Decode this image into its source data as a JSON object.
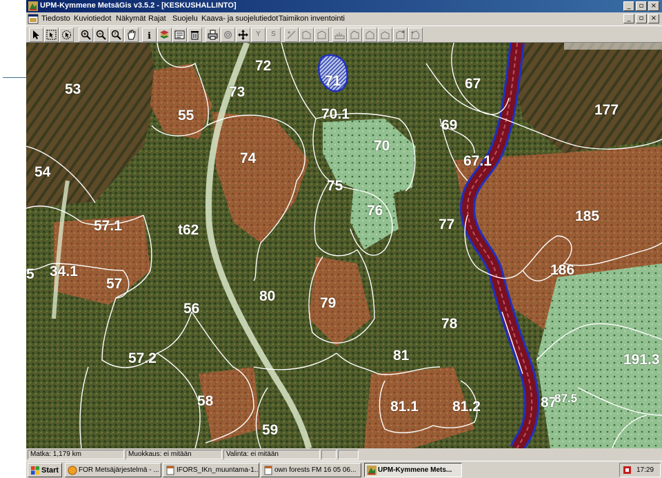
{
  "window": {
    "title": "UPM-Kymmene MetsäGis v3.5.2 - [KESKUSHALLINTO]"
  },
  "caption_buttons": [
    "_",
    "▫",
    "×"
  ],
  "menu": [
    "Tiedosto",
    "Kuviotiedot",
    "Näkymät",
    "Rajat",
    "Suojelu",
    "Kaava- ja suojelutiedot",
    "Taimikon inventointi"
  ],
  "toolbar": {
    "tools": [
      "select-arrow-icon",
      "select-area-icon",
      "select-circle-icon",
      "zoom-in-icon",
      "zoom-out-icon",
      "zoom-query-icon",
      "pan-hand-icon",
      "info-icon",
      "layers-icon",
      "legend-icon",
      "delete-icon",
      "print-icon",
      "settings-icon",
      "move-icon",
      "y-tool-icon",
      "s-tool-icon",
      "edit-line-icon",
      "polygon-icon",
      "polygon-icon",
      "measure-icon",
      "polygon-icon",
      "polygon-icon",
      "polygon-icon",
      "polygon-icon",
      "polygon-icon"
    ],
    "y_label": "Y",
    "s_label": "S"
  },
  "map": {
    "stand_labels": [
      "53",
      "72",
      "71",
      "73",
      "67",
      "177",
      "55",
      "70.1",
      "69",
      "70",
      "54",
      "74",
      "67.1",
      "75",
      "76",
      "185",
      "57.1",
      "t62",
      "77",
      "5",
      "34.1",
      "186",
      "57",
      "80",
      "79",
      "56",
      "78",
      "57.2",
      "81",
      "191.3",
      "58",
      "81.1",
      "81.2",
      "87",
      "87.5",
      "59"
    ],
    "colors": {
      "stand_boundary": "#ffffff",
      "river": "#7a1020",
      "river_edge": "#2030c0",
      "forest_dark": "#3d4a22",
      "clearing": "#9a5a32",
      "young_stand": "#8ec08a"
    }
  },
  "status": {
    "distance": "Matka: 1,179 km",
    "edit": "Muokkaus: ei mitään",
    "selection": "Valinta: ei mitään"
  },
  "taskbar": {
    "start": "Start",
    "tasks": [
      "FOR Metsäjärjestelmä - ...",
      "IFORS_IKn_muuntama-1...",
      "own forests FM 16 05 06...",
      "UPM-Kymmene Mets..."
    ],
    "clock": "17:29"
  }
}
